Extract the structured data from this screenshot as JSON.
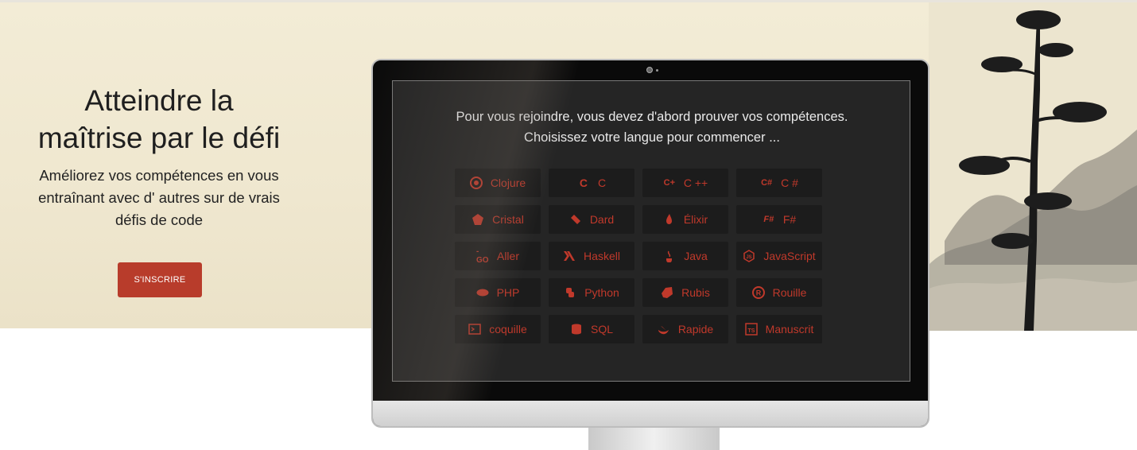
{
  "hero": {
    "title_line1": "Atteindre la",
    "title_line2": "maîtrise par le défi",
    "subtitle_line1": "Améliorez vos compétences en vous",
    "subtitle_line2": "entraînant avec d' autres sur de vrais",
    "subtitle_line3": "défis de code",
    "cta_label": "S'INSCRIRE"
  },
  "screen": {
    "prompt_line1": "Pour vous rejoindre, vous devez d'abord prouver vos compétences.",
    "prompt_line2": "Choisissez votre langue pour commencer ..."
  },
  "languages": [
    {
      "label": "Clojure",
      "icon": "clojure-icon"
    },
    {
      "label": "C",
      "icon": "c-icon"
    },
    {
      "label": "C ++",
      "icon": "cpp-icon"
    },
    {
      "label": "C #",
      "icon": "csharp-icon"
    },
    {
      "label": "Cristal",
      "icon": "crystal-icon"
    },
    {
      "label": "Dard",
      "icon": "dart-icon"
    },
    {
      "label": "Élixir",
      "icon": "elixir-icon"
    },
    {
      "label": "F#",
      "icon": "fsharp-icon"
    },
    {
      "label": "Aller",
      "icon": "go-icon"
    },
    {
      "label": "Haskell",
      "icon": "haskell-icon"
    },
    {
      "label": "Java",
      "icon": "java-icon"
    },
    {
      "label": "JavaScript",
      "icon": "javascript-icon"
    },
    {
      "label": "PHP",
      "icon": "php-icon"
    },
    {
      "label": "Python",
      "icon": "python-icon"
    },
    {
      "label": "Rubis",
      "icon": "ruby-icon"
    },
    {
      "label": "Rouille",
      "icon": "rust-icon"
    },
    {
      "label": "coquille",
      "icon": "shell-icon"
    },
    {
      "label": "SQL",
      "icon": "sql-icon"
    },
    {
      "label": "Rapide",
      "icon": "swift-icon"
    },
    {
      "label": "Manuscrit",
      "icon": "typescript-icon"
    }
  ],
  "colors": {
    "accent": "#c0392b",
    "button": "#b83c2b",
    "screen_bg": "#252525",
    "tile_bg": "#1c1c1c"
  }
}
